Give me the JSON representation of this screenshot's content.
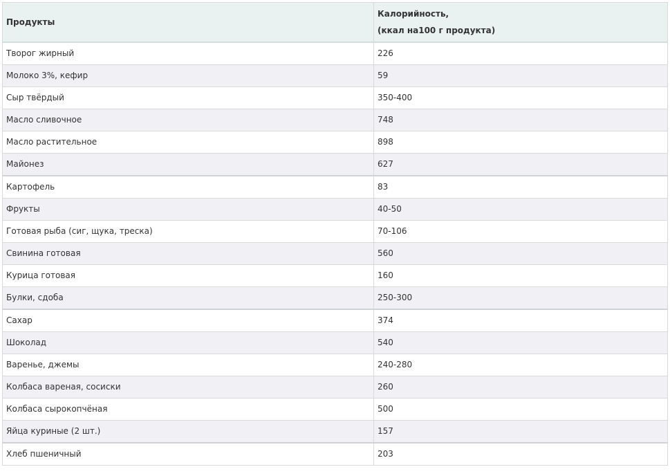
{
  "table": {
    "headers": {
      "product": "Продукты",
      "calories_line1": "Калорийность,",
      "calories_line2": "(ккал на100 г продукта)"
    },
    "rows": [
      {
        "product": "Творог жирный",
        "calories": "226"
      },
      {
        "product": "Молоко 3%, кефир",
        "calories": "59"
      },
      {
        "product": "Сыр твёрдый",
        "calories": "350-400"
      },
      {
        "product": "Масло сливочное",
        "calories": "748"
      },
      {
        "product": "Масло растительное",
        "calories": "898"
      },
      {
        "product": "Майонез",
        "calories": "627"
      },
      {
        "product": "Картофель",
        "calories": "83"
      },
      {
        "product": "Фрукты",
        "calories": "40-50"
      },
      {
        "product": "Готовая рыба (сиг, щука, треска)",
        "calories": "70-106"
      },
      {
        "product": "Свинина готовая",
        "calories": "560"
      },
      {
        "product": "Курица готовая",
        "calories": "160"
      },
      {
        "product": "Булки, сдоба",
        "calories": "250-300"
      },
      {
        "product": "Сахар",
        "calories": "374"
      },
      {
        "product": "Шоколад",
        "calories": "540"
      },
      {
        "product": "Варенье, джемы",
        "calories": "240-280"
      },
      {
        "product": "Колбаса вареная, сосиски",
        "calories": "260"
      },
      {
        "product": "Колбаса сырокопчёная",
        "calories": "500"
      },
      {
        "product": "Яйца куриные (2 шт.)",
        "calories": "157"
      },
      {
        "product": "Хлеб пшеничный",
        "calories": "203"
      }
    ]
  }
}
